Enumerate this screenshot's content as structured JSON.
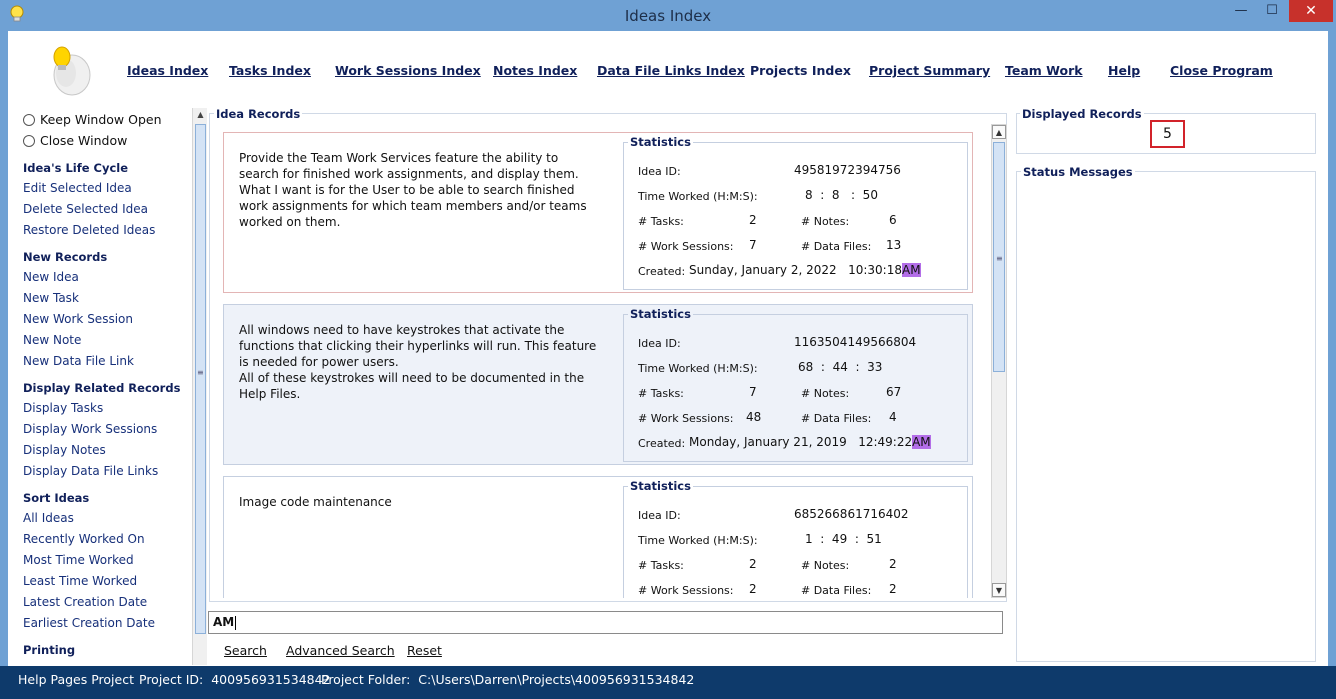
{
  "window": {
    "title": "Ideas Index",
    "minimize_glyph": "—",
    "maximize_glyph": "☐",
    "close_glyph": "✕"
  },
  "nav": [
    {
      "label": "Ideas Index"
    },
    {
      "label": "Tasks Index"
    },
    {
      "label": "Work Sessions Index"
    },
    {
      "label": "Notes Index"
    },
    {
      "label": "Data File Links Index"
    },
    {
      "label": "Projects Index"
    },
    {
      "label": "Project Summary"
    },
    {
      "label": "Team Work"
    },
    {
      "label": "Help"
    },
    {
      "label": "Close Program"
    }
  ],
  "sidebar": {
    "keep_open": "Keep Window Open",
    "close_window": "Close Window",
    "lifecycle": {
      "heading": "Idea's Life Cycle",
      "items": [
        "Edit Selected Idea",
        "Delete Selected Idea",
        "Restore Deleted Ideas"
      ]
    },
    "new_records": {
      "heading": "New Records",
      "items": [
        "New Idea",
        "New Task",
        "New Work Session",
        "New Note",
        "New Data File Link"
      ]
    },
    "related": {
      "heading": "Display Related Records",
      "items": [
        "Display Tasks",
        "Display Work Sessions",
        "Display Notes",
        "Display Data File Links"
      ]
    },
    "sort": {
      "heading": "Sort Ideas",
      "items": [
        "All Ideas",
        "Recently Worked On",
        "Most Time Worked",
        "Least Time Worked",
        "Latest Creation Date",
        "Earliest Creation Date"
      ]
    },
    "printing": {
      "heading": "Printing"
    }
  },
  "records_panel": {
    "title": "Idea Records",
    "stats_title": "Statistics",
    "labels": {
      "idea_id": "Idea ID:",
      "time_worked": "Time Worked (H:M:S):",
      "tasks": "# Tasks:",
      "notes": "# Notes:",
      "work_sessions": "# Work Sessions:",
      "data_files": "# Data Files:",
      "created": "Created:"
    },
    "records": [
      {
        "description": "Provide the Team Work Services feature the ability to search for finished work assignments, and display them. What I want is for the User to be able to search finished work assignments for which team members and/or teams worked on them.",
        "idea_id": "49581972394756",
        "time_worked": "8  :  8   :  50",
        "tasks": "2",
        "notes": "6",
        "work_sessions": "7",
        "data_files": "13",
        "created": "Sunday, January 2, 2022   10:30:18",
        "created_ampm": "AM"
      },
      {
        "description": "All windows need to have keystrokes that activate the functions that clicking their hyperlinks will run. This feature is needed for power users.\nAll of these keystrokes will need to be documented in the Help Files.",
        "idea_id": "1163504149566804",
        "time_worked": "68  :  44  :  33",
        "tasks": "7",
        "notes": "67",
        "work_sessions": "48",
        "data_files": "4",
        "created": "Monday, January 21, 2019   12:49:22",
        "created_ampm": "AM"
      },
      {
        "description": "Image code maintenance",
        "idea_id": "685266861716402",
        "time_worked": "1  :  49  :  51",
        "tasks": "2",
        "notes": "2",
        "work_sessions": "2",
        "data_files": "2",
        "created": "",
        "created_ampm": ""
      }
    ]
  },
  "search": {
    "value": "AM",
    "search_label": "Search",
    "advanced_label": "Advanced Search",
    "reset_label": "Reset"
  },
  "right": {
    "displayed_title": "Displayed Records",
    "displayed_count": "5",
    "status_title": "Status Messages"
  },
  "statusbar": {
    "project_name": "Help Pages Project",
    "project_id": "Project ID:  400956931534842",
    "project_folder": "Project Folder:  C:\\Users\\Darren\\Projects\\400956931534842"
  }
}
